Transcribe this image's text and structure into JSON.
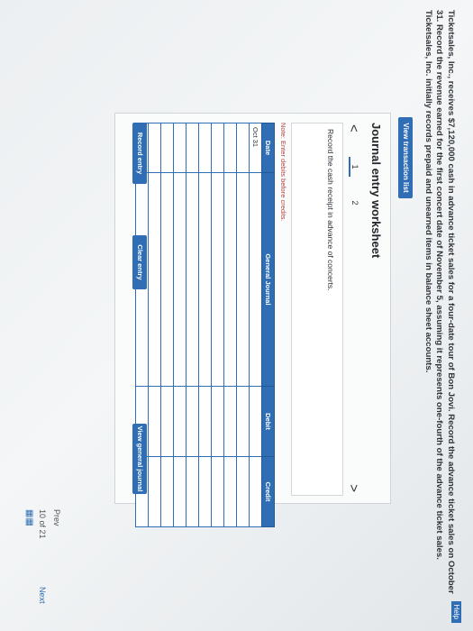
{
  "header": {
    "help": "Help"
  },
  "problem": {
    "text": "Ticketsales, Inc., receives $7,120,000 cash in advance ticket sales for a four-date tour of Bon Jovi. Record the advance ticket sales on October 31. Record the revenue earned for the first concert date of November 5, assuming it represents one-fourth of the advance ticket sales. Ticketsales, Inc. initially records prepaid and unearned items in balance sheet accounts."
  },
  "view_transaction_list": "View transaction list",
  "worksheet": {
    "title": "Journal entry worksheet",
    "prev_arrow": "<",
    "next_arrow": ">",
    "pages": [
      "1",
      "2"
    ],
    "instruction": "Record the cash receipt in advance of concerts.",
    "note": "Note: Enter debits before credits.",
    "table": {
      "headers": {
        "date": "Date",
        "general_journal": "General Journal",
        "debit": "Debit",
        "credit": "Credit"
      },
      "rows": [
        {
          "date": "Oct 31"
        },
        {
          "date": ""
        },
        {
          "date": ""
        },
        {
          "date": ""
        },
        {
          "date": ""
        },
        {
          "date": ""
        },
        {
          "date": ""
        },
        {
          "date": ""
        },
        {
          "date": ""
        },
        {
          "date": ""
        }
      ]
    },
    "buttons": {
      "record": "Record entry",
      "clear": "Clear entry",
      "view_gj": "View general journal"
    }
  },
  "footer": {
    "prev": "Prev",
    "count": "10 of 21",
    "next": "Next",
    "grid_icon": "grid-icon"
  },
  "colors": {
    "accent": "#2f6eb5",
    "note": "#b0413e"
  }
}
